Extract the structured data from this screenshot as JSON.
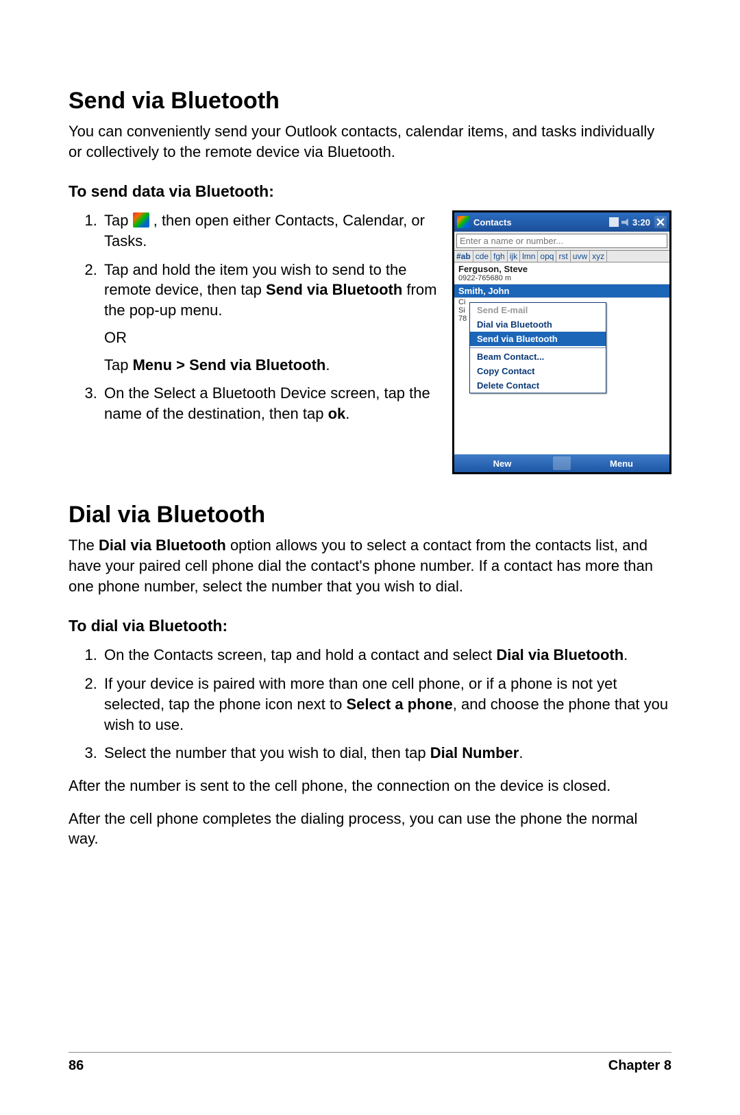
{
  "section1": {
    "heading": "Send via Bluetooth",
    "intro": "You can conveniently send your Outlook contacts, calendar items, and tasks individually or collectively to the remote device via Bluetooth.",
    "subheading": "To send data via Bluetooth:",
    "steps": {
      "s1a": "Tap ",
      "s1b": " , then open either Contacts, Calendar, or Tasks.",
      "s2a": "Tap and hold the item you wish to send to the remote device, then tap ",
      "s2b_bold": "Send via Bluetooth",
      "s2c": " from the pop-up menu.",
      "s2_or": "OR",
      "s2_alt_pre": "Tap ",
      "s2_alt_bold": "Menu > Send via Bluetooth",
      "s2_alt_post": ".",
      "s3a": "On the Select a Bluetooth Device screen, tap the name of the destination, then tap ",
      "s3b_bold": "ok",
      "s3c": "."
    }
  },
  "section2": {
    "heading": "Dial via Bluetooth",
    "intro_a": "The ",
    "intro_bold": "Dial via Bluetooth",
    "intro_b": " option allows you to select a contact from the contacts list, and have your paired cell phone dial the contact's phone number. If a contact has more than one phone number, select the number that you wish to dial.",
    "subheading": "To dial via Bluetooth:",
    "steps": {
      "s1a": "On the Contacts screen, tap and hold a contact and select ",
      "s1b_bold": "Dial via Bluetooth",
      "s1c": ".",
      "s2a": "If your device is paired with more than one cell phone, or if a phone is not yet selected, tap the phone icon next to ",
      "s2b_bold": "Select a phone",
      "s2c": ", and choose the phone that you wish to use.",
      "s3a": "Select the number that you wish to dial, then tap ",
      "s3b_bold": "Dial Number",
      "s3c": "."
    },
    "after1": "After the number is sent to the cell phone, the connection on the device is closed.",
    "after2": "After the cell phone completes the dialing process, you can use the phone the normal way."
  },
  "footer": {
    "page": "86",
    "chapter": "Chapter 8"
  },
  "screenshot": {
    "title": "Contacts",
    "time": "3:20",
    "search_placeholder": "Enter a name or number...",
    "alpha": [
      "#ab",
      "cde",
      "fgh",
      "ijk",
      "lmn",
      "opq",
      "rst",
      "uvw",
      "xyz"
    ],
    "contact1_name": "Ferguson, Steve",
    "contact1_num": "0922-765680  m",
    "contact2_name": "Smith, John",
    "hidden1": "Ci",
    "hidden2": "Si",
    "hidden3": "78",
    "menu": {
      "m1": "Send E-mail",
      "m2": "Dial via Bluetooth",
      "m3": "Send via Bluetooth",
      "m4": "Beam Contact...",
      "m5": "Copy Contact",
      "m6": "Delete Contact"
    },
    "softkeys": {
      "left": "New",
      "right": "Menu"
    }
  }
}
